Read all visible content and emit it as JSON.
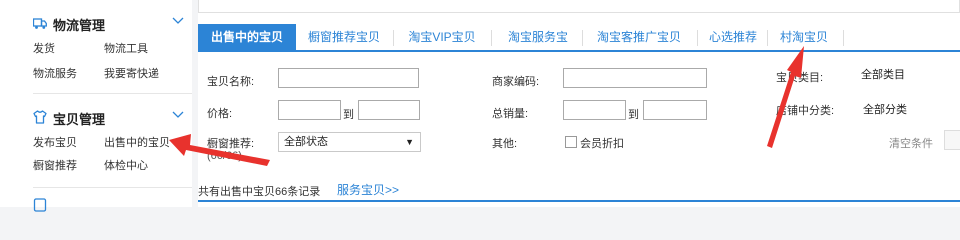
{
  "sidebar": {
    "groups": [
      {
        "title": "物流管理",
        "icon": "truck-icon",
        "links": [
          "发货",
          "物流工具",
          "物流服务",
          "我要寄快递"
        ]
      },
      {
        "title": "宝贝管理",
        "icon": "shirt-icon",
        "links": [
          "发布宝贝",
          "出售中的宝贝",
          "橱窗推荐",
          "体检中心"
        ]
      },
      {
        "title": "",
        "icon": "doc-icon",
        "links": []
      }
    ]
  },
  "tabs": [
    "出售中的宝贝",
    "橱窗推荐宝贝",
    "淘宝VIP宝贝",
    "淘宝服务宝",
    "淘宝客推广宝贝",
    "心选推荐",
    "村淘宝贝"
  ],
  "form": {
    "name_label": "宝贝名称:",
    "code_label": "商家编码:",
    "category_label": "宝贝类目:",
    "category_value": "全部类目",
    "price_label": "价格:",
    "to_1": "到",
    "sales_label": "总销量:",
    "to_2": "到",
    "shop_category_label": "店铺中分类:",
    "shop_category_value": "全部分类",
    "window_label": "橱窗推荐:",
    "window_value": "全部状态",
    "window_count": "(66/66)",
    "other_label": "其他:",
    "member_discount": "会员折扣",
    "clear": "清空条件"
  },
  "summary": "共有出售中宝贝66条记录",
  "service_link": "服务宝贝>>",
  "colors": {
    "accent": "#2c84d6",
    "annotation": "#e8322d"
  }
}
